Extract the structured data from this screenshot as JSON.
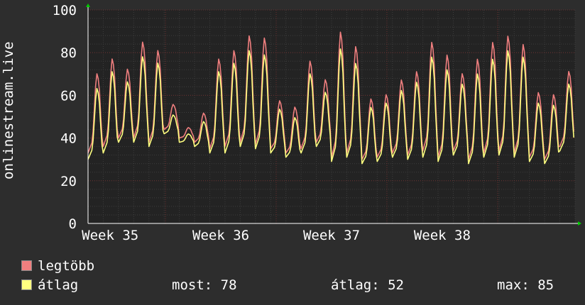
{
  "chart_data": {
    "type": "line",
    "ylabel": "onlinestream.live",
    "ylim": [
      0,
      100
    ],
    "yticks": [
      0,
      20,
      40,
      60,
      80,
      100
    ],
    "xticks": [
      "Week 35",
      "Week 36",
      "Week 37",
      "Week 38"
    ],
    "grid": true,
    "legend_position": "bottom",
    "colors": {
      "background": "#2d2d2d",
      "plot": "#232323",
      "grid_minor": "#3d3d3d",
      "grid_major": "#6a2f2f",
      "axis": "#ffffff"
    },
    "series": [
      {
        "name": "legtöbb",
        "color": "#f07f7f",
        "daily_max": [
          71,
          78,
          73,
          86,
          82,
          56,
          45,
          52,
          78,
          82,
          89,
          88,
          58,
          55,
          77,
          68,
          91,
          84,
          59,
          61,
          68,
          72,
          86,
          80,
          71,
          78,
          86,
          89,
          85,
          62,
          61,
          72
        ],
        "daily_min": [
          33,
          36,
          40,
          40,
          38,
          44,
          40,
          38,
          35,
          36,
          38,
          37,
          35,
          33,
          35,
          38,
          31,
          33,
          30,
          31,
          33,
          32,
          34,
          31,
          34,
          30,
          33,
          34,
          33,
          31,
          30,
          36
        ]
      },
      {
        "name": "átlag",
        "color": "#ffff80",
        "daily_max": [
          64,
          72,
          67,
          79,
          76,
          51,
          42,
          48,
          72,
          76,
          82,
          80,
          54,
          50,
          71,
          62,
          83,
          76,
          55,
          57,
          63,
          67,
          79,
          73,
          66,
          71,
          78,
          82,
          79,
          57,
          56,
          66
        ],
        "daily_min": [
          30,
          33,
          38,
          38,
          36,
          42,
          38,
          36,
          33,
          33,
          36,
          35,
          33,
          31,
          33,
          36,
          29,
          31,
          28,
          29,
          31,
          30,
          31,
          29,
          32,
          28,
          31,
          32,
          31,
          29,
          28,
          34
        ]
      }
    ]
  },
  "legend": [
    {
      "label": "legtöbb",
      "color": "#f07f7f"
    },
    {
      "label": "átlag",
      "color": "#ffff80"
    }
  ],
  "stats": {
    "most": "most: 78",
    "atlag": "átlag: 52",
    "max": "max: 85"
  }
}
